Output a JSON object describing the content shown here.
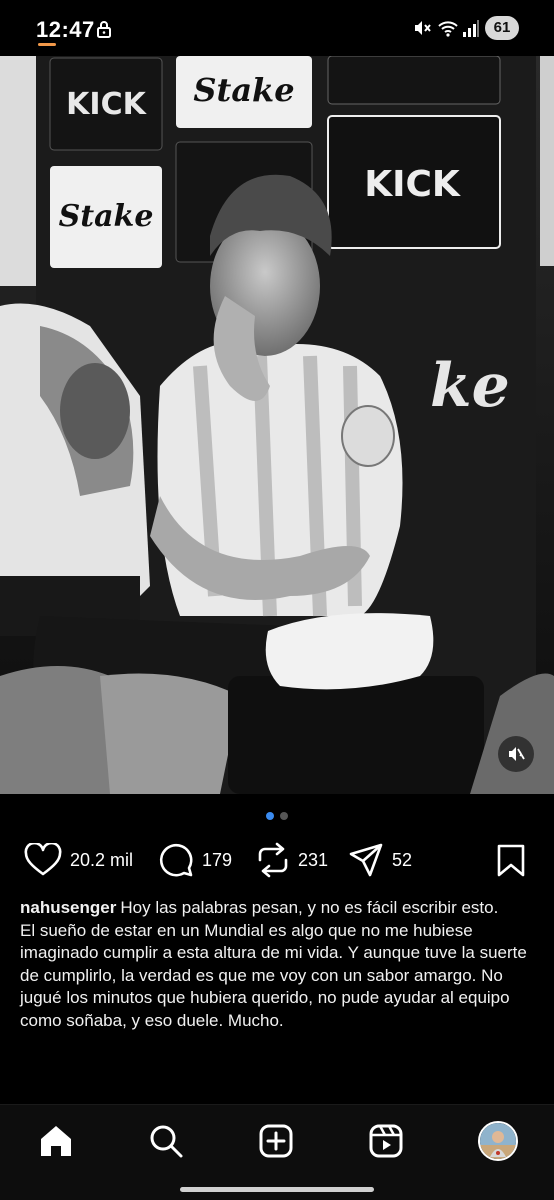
{
  "status_bar": {
    "time": "12:47",
    "battery": "61",
    "icons": [
      "lock-icon",
      "mute-icon",
      "wifi-icon",
      "signal-icon"
    ]
  },
  "post": {
    "image_alt_icon": "photo",
    "sound_icon": "sound-off-icon",
    "carousel": {
      "total": 2,
      "active": 1
    },
    "actions": {
      "likes": "20.2 mil",
      "comments": "179",
      "reposts": "231",
      "shares": "52"
    },
    "caption": {
      "username": "nahusenger",
      "text": "Hoy las palabras pesan, y no es fácil escribir esto.\nEl sueño de estar en un Mundial es algo que no me hubiese imaginado cumplir a esta altura de mi vida. Y aunque tuve la suerte de cumplirlo, la verdad es que me voy con un sabor amargo. No jugué los minutos que hubiera querido, no pude ayudar al equipo como soñaba, y eso duele. Mucho."
    }
  },
  "bottom_nav": {
    "items": [
      "home-icon",
      "search-icon",
      "create-icon",
      "reels-icon",
      "profile-avatar"
    ]
  },
  "colors": {
    "accent_dot": "#3a8bf0",
    "background": "#000000",
    "text": "#ffffff"
  }
}
